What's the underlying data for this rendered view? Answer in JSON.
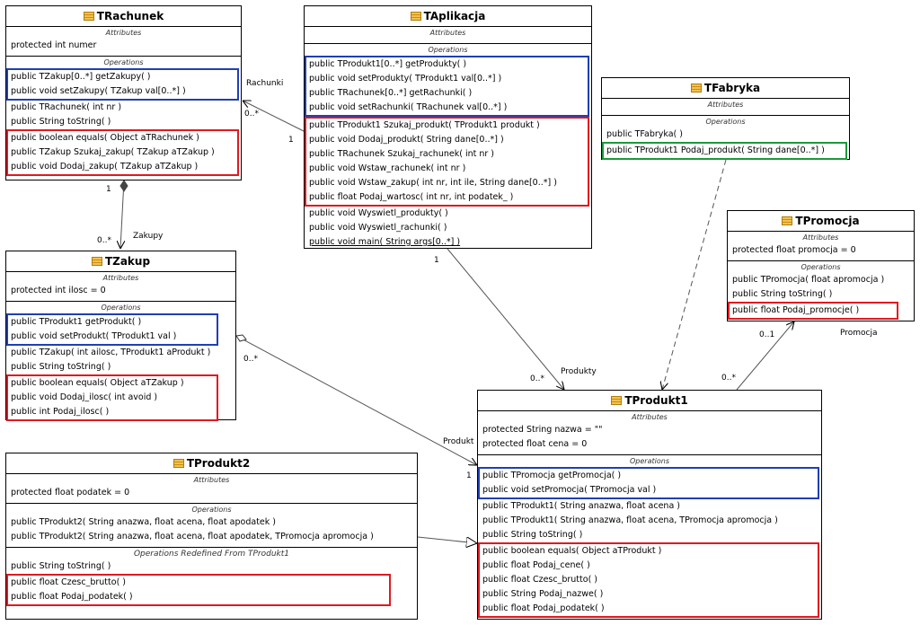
{
  "diagram": {
    "section_titles": {
      "attributes": "Attributes",
      "operations": "Operations",
      "redefined": "Operations Redefined From TProdukt1"
    },
    "classes": {
      "trachunek": {
        "name": "TRachunek",
        "attributes": [
          "protected int numer"
        ],
        "ops_blue": [
          "public TZakup[0..*]  getZakupy(  )",
          "public void  setZakupy( TZakup val[0..*] )"
        ],
        "ops_plain": [
          "public TRachunek( int nr )",
          "public String  toString(  )"
        ],
        "ops_red": [
          "public boolean  equals( Object aTRachunek )",
          "public TZakup  Szukaj_zakup( TZakup aTZakup )",
          "public void  Dodaj_zakup( TZakup aTZakup )"
        ]
      },
      "taplikacja": {
        "name": "TAplikacja",
        "ops_blue": [
          "public TProdukt1[0..*]  getProdukty(  )",
          "public void  setProdukty( TProdukt1 val[0..*] )",
          "public TRachunek[0..*]  getRachunki(  )",
          "public void  setRachunki( TRachunek val[0..*] )"
        ],
        "ops_red": [
          "public TProdukt1  Szukaj_produkt( TProdukt1 produkt )",
          "public void  Dodaj_produkt( String dane[0..*] )",
          "public TRachunek  Szukaj_rachunek( int nr )",
          "public void  Wstaw_rachunek( int nr )",
          "public void  Wstaw_zakup( int nr, int ile, String dane[0..*] )",
          "public float  Podaj_wartosc( int nr, int podatek_ )"
        ],
        "ops_plain": [
          "public void  Wyswietl_produkty(  )",
          "public void  Wyswietl_rachunki(  )"
        ],
        "ops_static": [
          "public void  main( String args[0..*] )"
        ]
      },
      "tfabryka": {
        "name": "TFabryka",
        "ops_plain": [
          "public TFabryka(  )"
        ],
        "ops_green": [
          "public TProdukt1  Podaj_produkt( String dane[0..*] )"
        ]
      },
      "tpromocja": {
        "name": "TPromocja",
        "attributes": [
          "protected float promocja = 0"
        ],
        "ops_plain": [
          "public TPromocja( float apromocja )",
          "public String  toString(  )"
        ],
        "ops_red": [
          "public float  Podaj_promocje(  )"
        ]
      },
      "tzakup": {
        "name": "TZakup",
        "attributes": [
          "protected int ilosc = 0"
        ],
        "ops_blue": [
          "public TProdukt1  getProdukt(  )",
          "public void  setProdukt( TProdukt1 val )"
        ],
        "ops_plain": [
          "public TZakup( int ailosc, TProdukt1 aProdukt )",
          "public String  toString(  )"
        ],
        "ops_red": [
          "public boolean  equals( Object aTZakup )",
          "public void  Dodaj_ilosc( int avoid )",
          "public int  Podaj_ilosc(  )"
        ]
      },
      "tprodukt2": {
        "name": "TProdukt2",
        "attributes": [
          "protected float podatek = 0"
        ],
        "ops_plain": [
          "public TProdukt2( String anazwa, float acena, float apodatek )",
          "public TProdukt2( String anazwa, float acena, float apodatek, TPromocja apromocja )"
        ],
        "redef_plain": [
          "public String  toString(  )"
        ],
        "redef_red": [
          "public float  Czesc_brutto(  )",
          "public float  Podaj_podatek(  )"
        ]
      },
      "tprodukt1": {
        "name": "TProdukt1",
        "attributes": [
          "protected String nazwa = \"\"",
          "protected float cena = 0"
        ],
        "ops_blue": [
          "public TPromocja  getPromocja(  )",
          "public void  setPromocja( TPromocja val )"
        ],
        "ops_plain": [
          "public TProdukt1( String anazwa, float acena )",
          "public TProdukt1( String anazwa, float acena, TPromocja apromocja )",
          "public String  toString(  )"
        ],
        "ops_red": [
          "public boolean  equals( Object aTProdukt )",
          "public float  Podaj_cene(  )",
          "public float  Czesc_brutto(  )",
          "public String  Podaj_nazwe(  )",
          "public float  Podaj_podatek(  )"
        ]
      }
    },
    "labels": {
      "rachunki_role": "Rachunki",
      "rachunki_mult_many": "0..*",
      "rachunki_mult_one": "1",
      "zakupy_mult_one": "1",
      "zakupy_mult_many": "0..*",
      "zakupy_role": "Zakupy",
      "produkty_mult_one": "1",
      "produkty_mult_many": "0..*",
      "produkty_role": "Produkty",
      "produkt_mult_many": "0..*",
      "produkt_role": "Produkt",
      "produkt_mult_one": "1",
      "promocja_mult_many": "0..*",
      "promocja_mult_opt": "0..1",
      "promocja_role": "Promocja"
    }
  }
}
